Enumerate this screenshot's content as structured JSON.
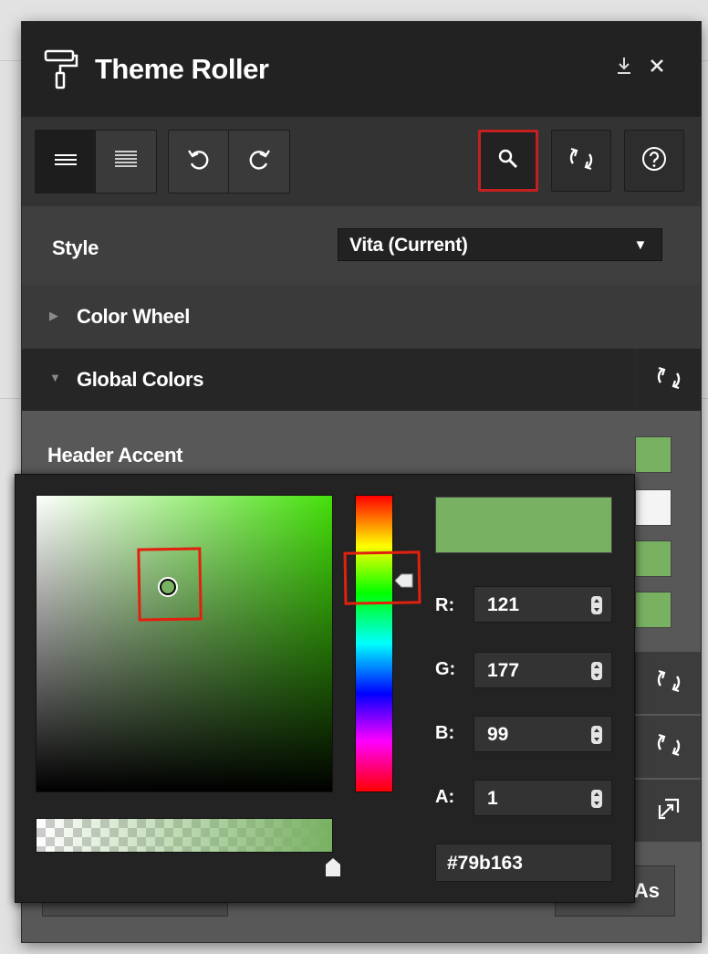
{
  "title": "Theme Roller",
  "style": {
    "label": "Style",
    "value": "Vita (Current)"
  },
  "sections": {
    "color_wheel": "Color Wheel",
    "global_colors": "Global Colors"
  },
  "field": {
    "label": "Header Accent"
  },
  "swatches": [
    "#79b163",
    "#f4f4f4",
    "#79b163",
    "#79b163"
  ],
  "picker": {
    "current_color": "#79b163",
    "channels": [
      {
        "label": "R:",
        "value": "121"
      },
      {
        "label": "G:",
        "value": "177"
      },
      {
        "label": "B:",
        "value": "99"
      },
      {
        "label": "A:",
        "value": "1"
      }
    ],
    "hex": "#79b163"
  },
  "bottom": {
    "save_as_partial": "As"
  },
  "colors": {
    "highlight_red": "#e2200e",
    "accent_green": "#79b163",
    "panel_bg": "#454545"
  }
}
